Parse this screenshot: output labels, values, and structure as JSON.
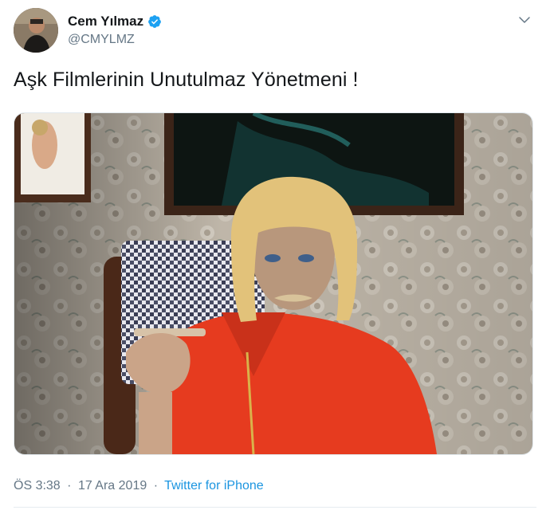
{
  "author": {
    "name": "Cem Yılmaz",
    "handle": "@CMYLMZ",
    "verified": true
  },
  "tweet": {
    "text": "Aşk Filmlerinin Unutulmaz Yönetmeni !"
  },
  "meta": {
    "time": "ÖS 3:38",
    "separator": "·",
    "date": "17 Ara 2019",
    "source": "Twitter for iPhone"
  },
  "icons": {
    "verified": "verified-badge-icon",
    "menu": "chevron-down-icon"
  },
  "colors": {
    "link": "#1b95e0",
    "secondary_text": "#657786",
    "verified": "#1da1f2",
    "shirt": "#e63b1f"
  }
}
